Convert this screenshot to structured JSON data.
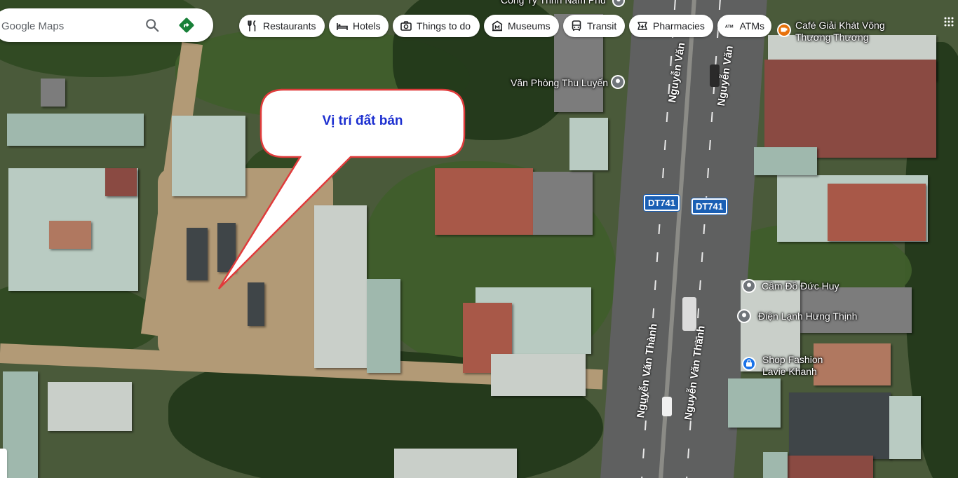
{
  "search": {
    "placeholder": "Google Maps"
  },
  "chips": [
    {
      "label": "Restaurants",
      "icon": "fork-knife-icon"
    },
    {
      "label": "Hotels",
      "icon": "bed-icon"
    },
    {
      "label": "Things to do",
      "icon": "camera-icon"
    },
    {
      "label": "Museums",
      "icon": "museum-icon"
    },
    {
      "label": "Transit",
      "icon": "bus-icon"
    },
    {
      "label": "Pharmacies",
      "icon": "pharmacy-icon"
    },
    {
      "label": "ATMs",
      "icon": "atm-icon"
    }
  ],
  "map": {
    "roads": {
      "main_road_left": "Nguyễn Văn Thành",
      "main_road_right": "Nguyễn Văn Thành",
      "upper_left": "Nguyễn Văn",
      "upper_right": "Nguyễn Văn",
      "shield_left": "DT741",
      "shield_right": "DT741"
    },
    "places": [
      {
        "name": "Văn Phòng Thu Luyến",
        "icon": "place-pin-icon"
      },
      {
        "name": "Café Giải Khát Võng",
        "name2": "Thương Thương",
        "icon": "cafe-pin-icon",
        "color": "#e8710a"
      },
      {
        "name": "Cầm Đồ Đức Huy",
        "icon": "place-pin-icon"
      },
      {
        "name": "Điện Lạnh Hưng Thịnh",
        "icon": "place-pin-icon"
      },
      {
        "name": "Shop Fashion",
        "name2": "Lavie Khanh",
        "icon": "shopping-pin-icon",
        "color": "#1a73e8"
      },
      {
        "name": "Công Ty Tnhh Nam Phú",
        "icon": "place-pin-icon"
      }
    ]
  },
  "callout": {
    "text": "Vị trí đất bán",
    "border_color": "#e03b3b",
    "text_color": "#1c2fd0"
  },
  "colors": {
    "accent_green": "#188038",
    "shield_blue": "#1a5fb4"
  }
}
